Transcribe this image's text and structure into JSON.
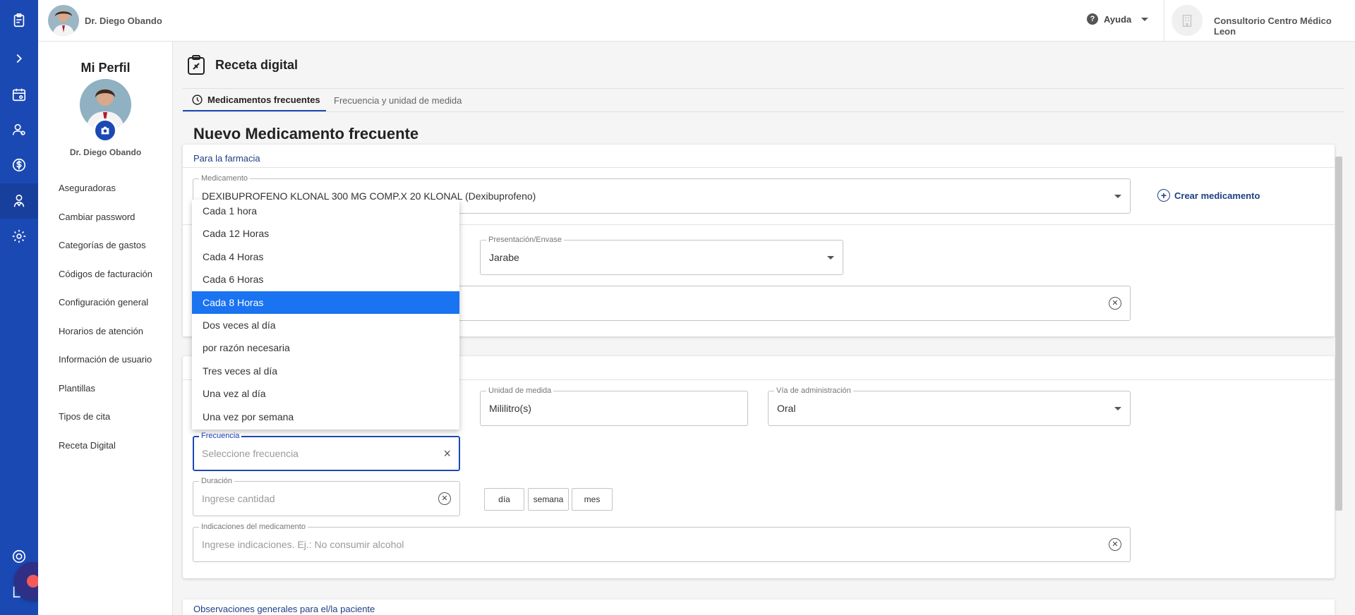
{
  "topbar": {
    "doctor_name": "Dr. Diego Obando",
    "help_label": "Ayuda",
    "clinic_name": "Consultorio Centro Médico Leon"
  },
  "profile": {
    "title": "Mi Perfil",
    "name": "Dr. Diego Obando",
    "menu": [
      {
        "label": "Aseguradoras"
      },
      {
        "label": "Cambiar password"
      },
      {
        "label": "Categorías de gastos"
      },
      {
        "label": "Códigos de facturación"
      },
      {
        "label": "Configuración general"
      },
      {
        "label": "Horarios de atención"
      },
      {
        "label": "Información de usuario"
      },
      {
        "label": "Plantillas"
      },
      {
        "label": "Tipos de cita"
      },
      {
        "label": "Receta Digital"
      }
    ]
  },
  "page": {
    "title": "Receta digital",
    "tabs": [
      {
        "label": "Medicamentos frecuentes",
        "active": true
      },
      {
        "label": "Frecuencia y unidad de medida",
        "active": false
      }
    ],
    "section_title": "Nuevo Medicamento frecuente"
  },
  "pharmacy_card": {
    "header": "Para la farmacia",
    "medicamento": {
      "label": "Medicamento",
      "value": "DEXIBUPROFENO KLONAL  300 MG COMP.X 20 KLONAL (Dexibuprofeno)"
    },
    "create_label": "Crear medicamento",
    "presentacion": {
      "label": "Presentación/Envase",
      "value": "Jarabe"
    }
  },
  "patient_card": {
    "unidad": {
      "label": "Unidad de medida",
      "value": "Mililitro(s)"
    },
    "via": {
      "label": "Vía de administración",
      "value": "Oral"
    },
    "frecuencia": {
      "label": "Frecuencia",
      "placeholder": "Seleccione frecuencia"
    },
    "duracion": {
      "label": "Duración",
      "placeholder": "Ingrese cantidad"
    },
    "duration_units": [
      "día",
      "semana",
      "mes"
    ],
    "indicaciones": {
      "label": "Indicaciones del medicamento",
      "placeholder": "Ingrese indicaciones. Ej.: No consumir alcohol"
    }
  },
  "frequency_dropdown": {
    "selected": "Cada 8 Horas",
    "options": [
      "Cada 1 hora",
      "Cada 12 Horas",
      "Cada 4 Horas",
      "Cada 6 Horas",
      "Cada 8 Horas",
      "Dos veces al día",
      "por razón necesaria",
      "Tres veces al día",
      "Una vez al día",
      "Una vez por semana"
    ]
  },
  "observaciones_label": "Observaciones generales para el/la paciente",
  "colors": {
    "rail": "#1b49b4",
    "accent_text": "#1d3f83",
    "selected_option": "#1a73f0",
    "record": "#f3595a"
  }
}
